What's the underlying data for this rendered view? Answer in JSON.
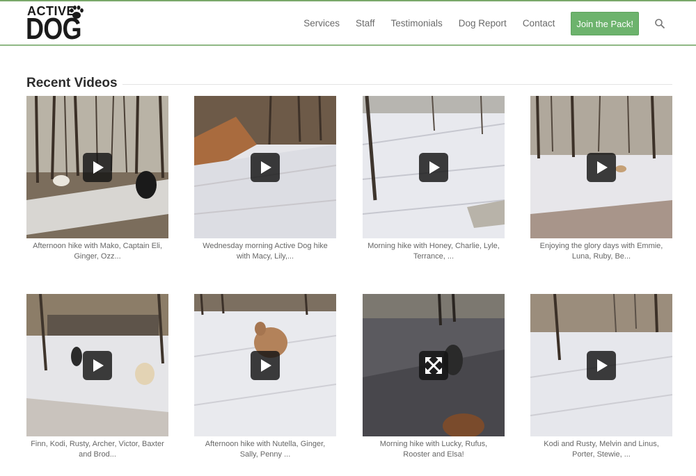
{
  "brand": {
    "logo_top": "ACTIVE",
    "logo_main": "DOG"
  },
  "nav": {
    "items": [
      "Services",
      "Staff",
      "Testimonials",
      "Dog Report",
      "Contact"
    ],
    "cta_label": "Join the Pack!",
    "search_icon": "search-icon"
  },
  "section": {
    "title": "Recent Videos"
  },
  "videos": [
    {
      "caption": "Afternoon hike with Mako, Captain Eli, Ginger, Ozz...",
      "overlay": "play-icon"
    },
    {
      "caption": "Wednesday morning Active Dog hike with Macy, Lily,...",
      "overlay": "play-icon"
    },
    {
      "caption": "Morning hike with Honey, Charlie, Lyle, Terrance, ...",
      "overlay": "play-icon"
    },
    {
      "caption": "Enjoying the glory days with Emmie, Luna, Ruby, Be...",
      "overlay": "play-icon"
    },
    {
      "caption": "Finn, Kodi, Rusty, Archer, Victor, Baxter and Brod...",
      "overlay": "play-icon"
    },
    {
      "caption": "Afternoon hike with Nutella, Ginger, Sally, Penny ...",
      "overlay": "play-icon"
    },
    {
      "caption": "Morning hike with Lucky, Rufus, Rooster and Elsa!",
      "overlay": "expand-icon"
    },
    {
      "caption": "Kodi and Rusty, Melvin and Linus, Porter, Stewie, ...",
      "overlay": "play-icon"
    }
  ],
  "colors": {
    "accent_green": "#6db36d",
    "header_rule": "#8fb884"
  }
}
